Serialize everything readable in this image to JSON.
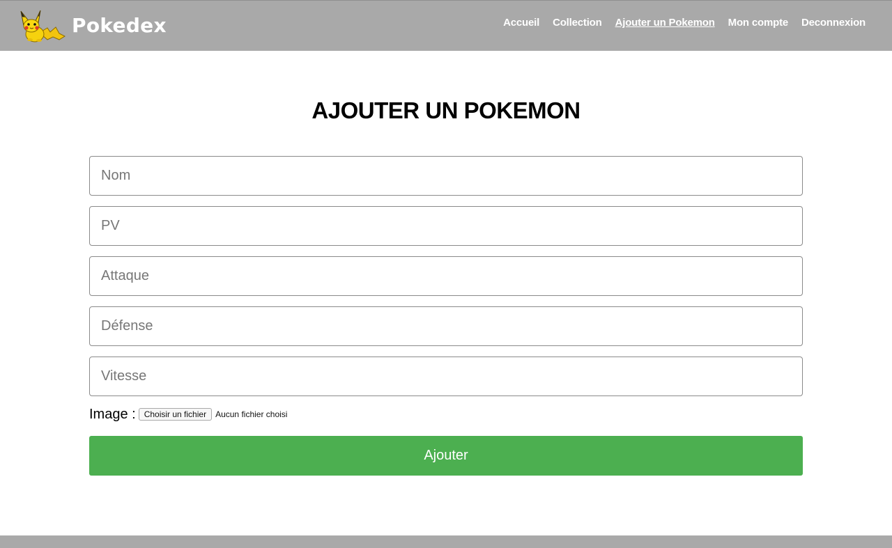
{
  "header": {
    "brand_name": "Pokedex",
    "logo_icon": "pikachu-logo-icon",
    "nav": [
      {
        "label": "Accueil",
        "active": false
      },
      {
        "label": "Collection",
        "active": false
      },
      {
        "label": "Ajouter un Pokemon",
        "active": true
      },
      {
        "label": "Mon compte",
        "active": false
      },
      {
        "label": "Deconnexion",
        "active": false
      }
    ]
  },
  "main": {
    "title": "AJOUTER UN POKEMON",
    "fields": {
      "nom": {
        "placeholder": "Nom",
        "value": ""
      },
      "pv": {
        "placeholder": "PV",
        "value": ""
      },
      "attaque": {
        "placeholder": "Attaque",
        "value": ""
      },
      "defense": {
        "placeholder": "Défense",
        "value": ""
      },
      "vitesse": {
        "placeholder": "Vitesse",
        "value": ""
      }
    },
    "image": {
      "label": "Image :",
      "button_label": "Choisir un fichier",
      "status": "Aucun fichier choisi"
    },
    "submit_label": "Ajouter"
  },
  "colors": {
    "header_bg": "#a9a9a9",
    "submit_bg": "#4caf50",
    "text_on_header": "#ffffff"
  }
}
